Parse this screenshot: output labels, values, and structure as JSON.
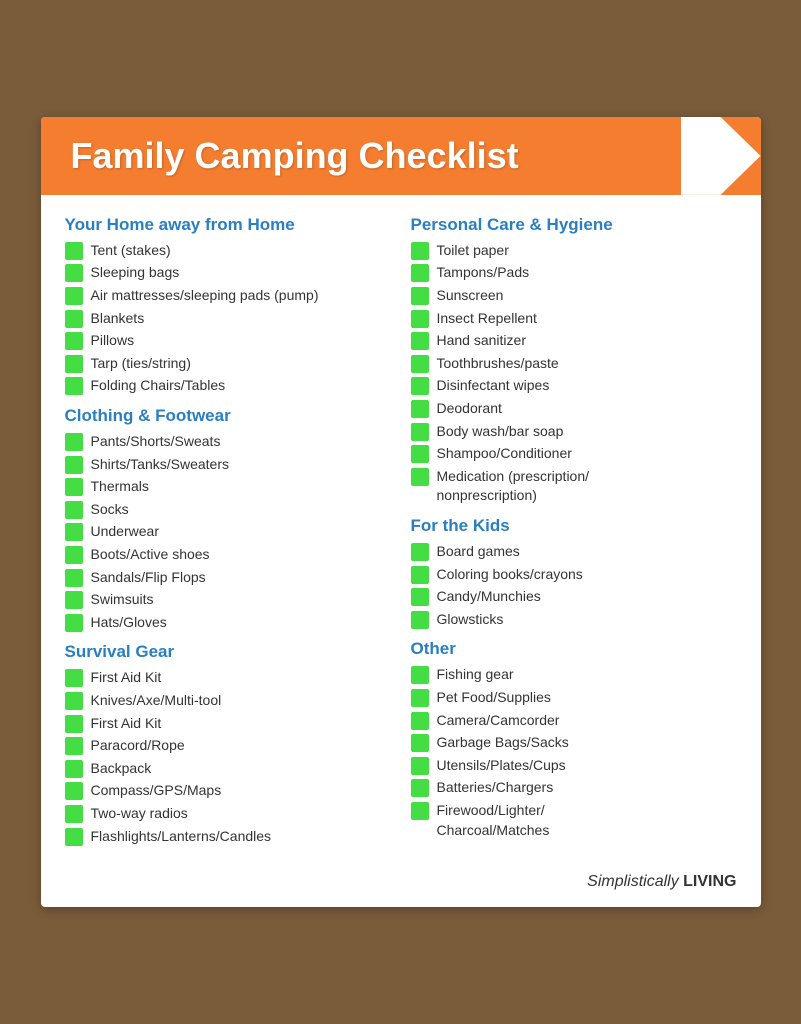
{
  "header": {
    "title": "Family Camping Checklist"
  },
  "left_column": {
    "sections": [
      {
        "title": "Your Home away from Home",
        "items": [
          "Tent (stakes)",
          "Sleeping bags",
          "Air mattresses/sleeping pads (pump)",
          "Blankets",
          "Pillows",
          "Tarp (ties/string)",
          "Folding Chairs/Tables"
        ]
      },
      {
        "title": "Clothing & Footwear",
        "items": [
          "Pants/Shorts/Sweats",
          "Shirts/Tanks/Sweaters",
          "Thermals",
          "Socks",
          "Underwear",
          "Boots/Active shoes",
          "Sandals/Flip Flops",
          "Swimsuits",
          "Hats/Gloves"
        ]
      },
      {
        "title": "Survival Gear",
        "items": [
          "First Aid Kit",
          "Knives/Axe/Multi-tool",
          "First Aid Kit",
          "Paracord/Rope",
          "Backpack",
          "Compass/GPS/Maps",
          "Two-way radios",
          "Flashlights/Lanterns/Candles"
        ]
      }
    ]
  },
  "right_column": {
    "sections": [
      {
        "title": "Personal Care & Hygiene",
        "items": [
          "Toilet paper",
          "Tampons/Pads",
          "Sunscreen",
          "Insect Repellent",
          "Hand sanitizer",
          "Toothbrushes/paste",
          "Disinfectant wipes",
          "Deodorant",
          "Body wash/bar soap",
          "Shampoo/Conditioner",
          "Medication (prescription/\nnonprescription)"
        ]
      },
      {
        "title": "For the Kids",
        "items": [
          "Board games",
          "Coloring books/crayons",
          "Candy/Munchies",
          "Glowsticks"
        ]
      },
      {
        "title": "Other",
        "items": [
          "Fishing gear",
          "Pet Food/Supplies",
          "Camera/Camcorder",
          "Garbage Bags/Sacks",
          "Utensils/Plates/Cups",
          "Batteries/Chargers",
          "Firewood/Lighter/\nCharcoal/Matches"
        ]
      }
    ]
  },
  "footer": {
    "brand_italic": "Simplistically",
    "brand_bold": "LIVING"
  }
}
